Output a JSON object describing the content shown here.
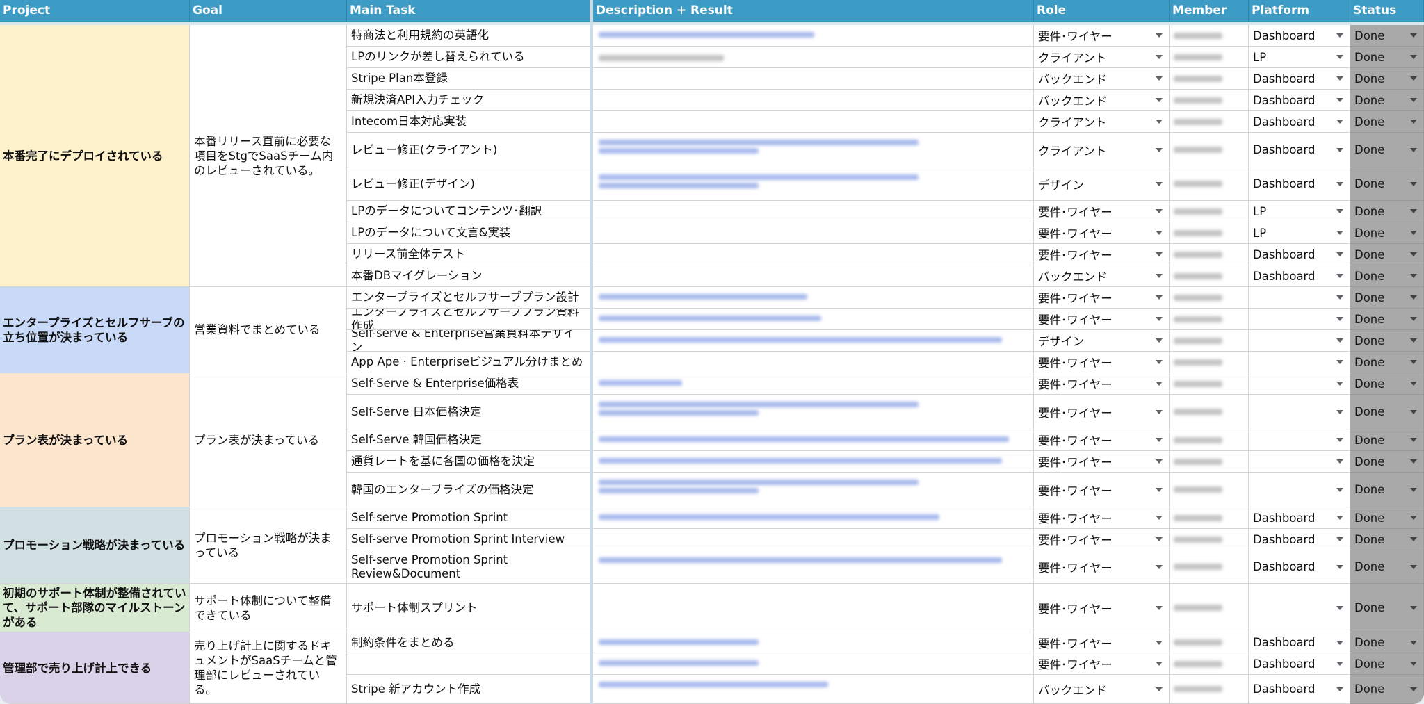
{
  "columns": [
    {
      "key": "project",
      "label": "Project"
    },
    {
      "key": "goal",
      "label": "Goal"
    },
    {
      "key": "task",
      "label": "Main Task"
    },
    {
      "key": "desc",
      "label": "Description + Result"
    },
    {
      "key": "role",
      "label": "Role"
    },
    {
      "key": "member",
      "label": "Member"
    },
    {
      "key": "platform",
      "label": "Platform"
    },
    {
      "key": "status",
      "label": "Status"
    }
  ],
  "groups": [
    {
      "project": "本番完了にデプロイされている",
      "goal": "本番リリース直前に必要な項目をStgでSaaSチーム内のレビューされている。",
      "color": "#fef2cc"
    },
    {
      "project": "エンタープライズとセルフサーブの立ち位置が決まっている",
      "goal": "営業資料でまとめている",
      "color": "#c9daf8"
    },
    {
      "project": "プラン表が決まっている",
      "goal": "プラン表が決まっている",
      "color": "#fce5cd"
    },
    {
      "project": "プロモーション戦略が決まっている",
      "goal": "プロモーション戦略が決まっている",
      "color": "#d0e0e3"
    },
    {
      "project": "初期のサポート体制が整備されていて、サポート部隊のマイルストーンがある",
      "goal": "サポート体制について整備できている",
      "color": "#d9ead3"
    },
    {
      "project": "管理部で売り上げ計上できる",
      "goal": "売り上げ計上に関するドキュメントがSaaSチームと管理部にレビューされている。",
      "color": "#d9d2e9"
    }
  ],
  "rows": [
    {
      "task": "特商法と利用規約の英語化",
      "role": "要件･ワイヤー",
      "platform": "Dashboard",
      "status": "Done"
    },
    {
      "task": "LPのリンクが差し替えられている",
      "role": "クライアント",
      "platform": "LP",
      "status": "Done"
    },
    {
      "task": "Stripe Plan本登録",
      "role": "バックエンド",
      "platform": "Dashboard",
      "status": "Done"
    },
    {
      "task": "新規決済API入力チェック",
      "role": "バックエンド",
      "platform": "Dashboard",
      "status": "Done"
    },
    {
      "task": "Intecom日本対応実装",
      "role": "クライアント",
      "platform": "Dashboard",
      "status": "Done"
    },
    {
      "task": "レビュー修正(クライアント)",
      "role": "クライアント",
      "platform": "Dashboard",
      "status": "Done"
    },
    {
      "task": "レビュー修正(デザイン)",
      "role": "デザイン",
      "platform": "Dashboard",
      "status": "Done"
    },
    {
      "task": "LPのデータについてコンテンツ･翻訳",
      "role": "要件･ワイヤー",
      "platform": "LP",
      "status": "Done"
    },
    {
      "task": "LPのデータについて文言&実装",
      "role": "要件･ワイヤー",
      "platform": "LP",
      "status": "Done"
    },
    {
      "task": "リリース前全体テスト",
      "role": "要件･ワイヤー",
      "platform": "Dashboard",
      "status": "Done"
    },
    {
      "task": "本番DBマイグレーション",
      "role": "バックエンド",
      "platform": "Dashboard",
      "status": "Done"
    },
    {
      "task": "エンタープライズとセルフサーブプラン設計",
      "role": "要件･ワイヤー",
      "platform": "",
      "status": "Done"
    },
    {
      "task": "エンタープライズとセルフサーブプラン資料作成",
      "role": "要件･ワイヤー",
      "platform": "",
      "status": "Done"
    },
    {
      "task": "Self-serve & Enterprise営業資料本デザイン",
      "role": "デザイン",
      "platform": "",
      "status": "Done"
    },
    {
      "task": "App Ape · Enterpriseビジュアル分けまとめ",
      "role": "要件･ワイヤー",
      "platform": "",
      "status": "Done"
    },
    {
      "task": "Self-Serve & Enterprise価格表",
      "role": "要件･ワイヤー",
      "platform": "",
      "status": "Done"
    },
    {
      "task": "Self-Serve 日本価格決定",
      "role": "要件･ワイヤー",
      "platform": "",
      "status": "Done"
    },
    {
      "task": "Self-Serve 韓国価格決定",
      "role": "要件･ワイヤー",
      "platform": "",
      "status": "Done"
    },
    {
      "task": "通貨レートを基に各国の価格を決定",
      "role": "要件･ワイヤー",
      "platform": "",
      "status": "Done"
    },
    {
      "task": "韓国のエンタープライズの価格決定",
      "role": "要件･ワイヤー",
      "platform": "",
      "status": "Done"
    },
    {
      "task": "Self-serve Promotion Sprint",
      "role": "要件･ワイヤー",
      "platform": "Dashboard",
      "status": "Done"
    },
    {
      "task": "Self-serve Promotion Sprint Interview",
      "role": "要件･ワイヤー",
      "platform": "Dashboard",
      "status": "Done"
    },
    {
      "task": "Self-serve Promotion Sprint Review&Document",
      "role": "要件･ワイヤー",
      "platform": "Dashboard",
      "status": "Done"
    },
    {
      "task": "サポート体制スプリント",
      "role": "要件･ワイヤー",
      "platform": "",
      "status": "Done"
    },
    {
      "task": "制約条件をまとめる",
      "role": "要件･ワイヤー",
      "platform": "Dashboard",
      "status": "Done"
    },
    {
      "task": "",
      "role": "要件･ワイヤー",
      "platform": "Dashboard",
      "status": "Done"
    },
    {
      "task": "Stripe 新アカウント作成",
      "role": "バックエンド",
      "platform": "Dashboard",
      "status": "Done"
    }
  ]
}
